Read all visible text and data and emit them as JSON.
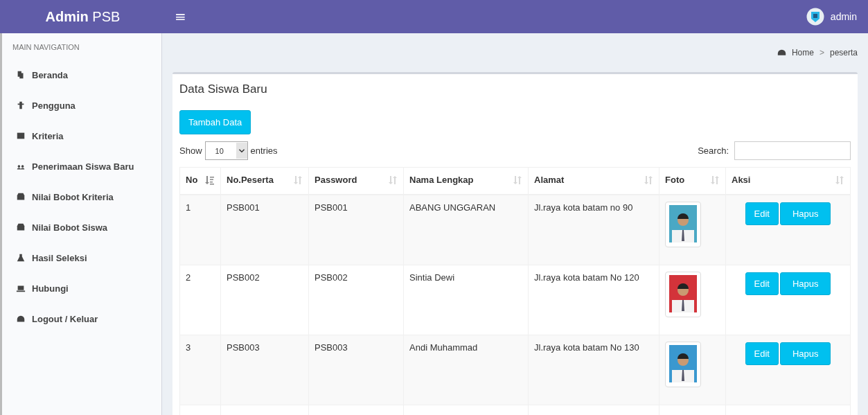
{
  "header": {
    "logo_bold": "Admin",
    "logo_rest": "PSB",
    "menu_toggle": "≡",
    "user": "admin"
  },
  "sidebar": {
    "heading": "MAIN NAVIGATION",
    "items": [
      {
        "label": "Beranda"
      },
      {
        "label": "Pengguna"
      },
      {
        "label": "Kriteria"
      },
      {
        "label": "Penerimaan Siswa Baru"
      },
      {
        "label": "Nilai Bobot Kriteria"
      },
      {
        "label": "Nilai Bobot Siswa"
      },
      {
        "label": "Hasil Seleksi"
      },
      {
        "label": "Hubungi"
      },
      {
        "label": "Logout / Keluar"
      }
    ]
  },
  "breadcrumb": {
    "items": [
      "Home",
      "peserta"
    ],
    "separator": ">"
  },
  "box": {
    "title": "Data Siswa Baru",
    "add_button": "Tambah Data",
    "show_label": "Show",
    "page_size": "10",
    "entries_label": "entries",
    "search_label": "Search:",
    "table": {
      "columns": [
        {
          "label": "No",
          "sorted": true
        },
        {
          "label": "No.Peserta",
          "sorted": false
        },
        {
          "label": "Password",
          "sorted": false
        },
        {
          "label": "Nama Lengkap",
          "sorted": false
        },
        {
          "label": "Alamat",
          "sorted": false
        },
        {
          "label": "Foto",
          "sorted": false
        },
        {
          "label": "Aksi",
          "sorted": false
        }
      ],
      "rows": [
        {
          "no": "1",
          "peserta": "PSB001",
          "password": "PSB001",
          "nama": "ABANG UNGGARAN",
          "alamat": "Jl.raya kota batam no 90",
          "actions": [
            "Edit",
            "Hapus"
          ]
        },
        {
          "no": "2",
          "peserta": "PSB002",
          "password": "PSB002",
          "nama": "Sintia Dewi",
          "alamat": "Jl.raya kota batam No 120",
          "actions": [
            "Edit",
            "Hapus"
          ]
        },
        {
          "no": "3",
          "peserta": "PSB003",
          "password": "PSB003",
          "nama": "Andi Muhammad",
          "alamat": "Jl.raya kota batam No 130",
          "actions": [
            "Edit",
            "Hapus"
          ]
        }
      ]
    }
  }
}
